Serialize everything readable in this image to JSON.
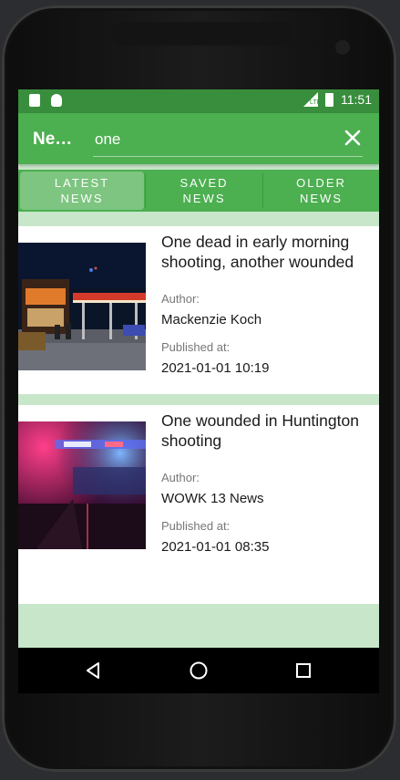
{
  "status_bar": {
    "time": "11:51",
    "network": "LTE",
    "icons": [
      "sd-card-icon",
      "android-icon",
      "signal-icon",
      "battery-icon"
    ]
  },
  "app_bar": {
    "title": "Ne…",
    "search_value": "one",
    "close_icon": "close-icon"
  },
  "tabs": [
    {
      "line1": "LATEST",
      "line2": "NEWS",
      "active": true
    },
    {
      "line1": "SAVED",
      "line2": "NEWS",
      "active": false
    },
    {
      "line1": "OLDER",
      "line2": "NEWS",
      "active": false
    }
  ],
  "articles": [
    {
      "title": "One dead in early morning shooting, another wounded",
      "author_label": "Author:",
      "author": "Mackenzie Koch",
      "published_label": "Published at:",
      "published": "2021-01-01 10:19",
      "image": "gas-station-night-photo"
    },
    {
      "title": "One wounded in Huntington shooting",
      "author_label": "Author:",
      "author": "WOWK 13 News",
      "published_label": "Published at:",
      "published": "2021-01-01 08:35",
      "image": "police-lights-photo"
    }
  ],
  "nav_bar": {
    "buttons": [
      "back-icon",
      "home-icon",
      "recents-icon"
    ]
  },
  "colors": {
    "primary": "#4caf50",
    "primary_dark": "#388e3c",
    "list_background": "#c8e6c9"
  }
}
